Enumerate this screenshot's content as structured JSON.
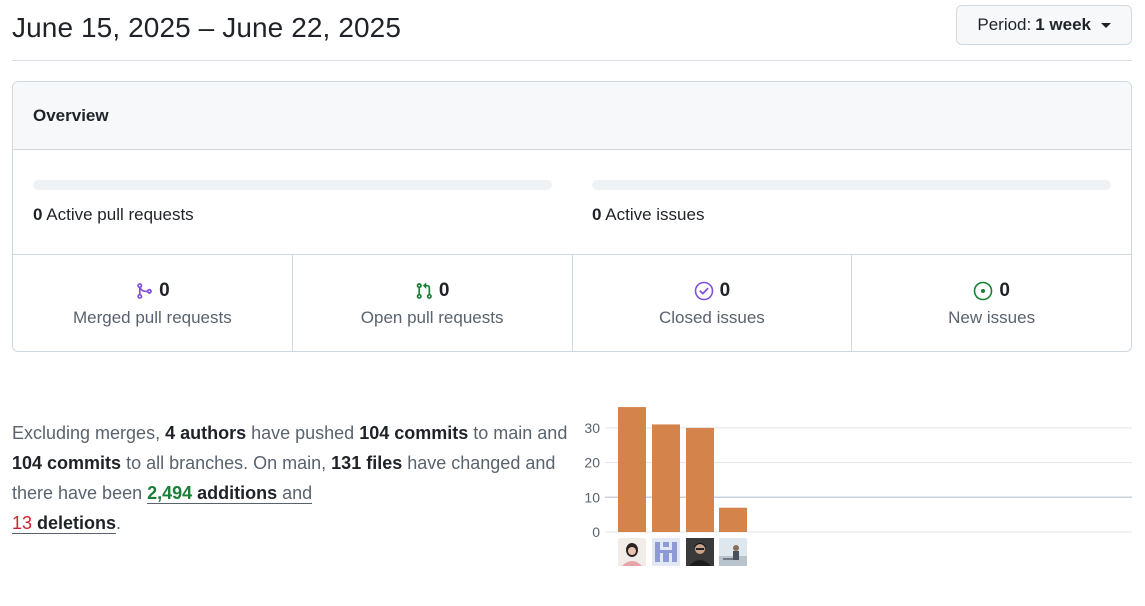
{
  "header": {
    "title": "June 15, 2025 – June 22, 2025",
    "period_label": "Period:",
    "period_value": "1 week"
  },
  "overview": {
    "title": "Overview",
    "active_prs": {
      "count": "0",
      "label": "Active pull requests"
    },
    "active_issues": {
      "count": "0",
      "label": "Active issues"
    },
    "stats": [
      {
        "count": "0",
        "label": "Merged pull requests",
        "icon": "git-merge-icon",
        "color": "#8250df"
      },
      {
        "count": "0",
        "label": "Open pull requests",
        "icon": "git-pull-request-icon",
        "color": "#1a7f37"
      },
      {
        "count": "0",
        "label": "Closed issues",
        "icon": "issue-closed-icon",
        "color": "#8250df"
      },
      {
        "count": "0",
        "label": "New issues",
        "icon": "issue-opened-icon",
        "color": "#1a7f37"
      }
    ]
  },
  "summary": {
    "t1": "Excluding merges, ",
    "authors": "4 authors",
    "t2": " have pushed ",
    "commits_main": "104 commits",
    "t3": " to main and ",
    "commits_all": "104 commits",
    "t4": " to all branches. On main, ",
    "files": "131 files",
    "t5": " have changed and there have been ",
    "additions_num": "2,494",
    "additions_word": " additions",
    "t6": " and",
    "deletions_num": "13",
    "deletions_word": " deletions",
    "t7": "."
  },
  "chart_data": {
    "type": "bar",
    "categories": [
      "author-1",
      "author-2",
      "author-3",
      "author-4"
    ],
    "values": [
      36,
      31,
      30,
      7
    ],
    "yticks": [
      "0",
      "10",
      "20",
      "30"
    ],
    "ylim": [
      0,
      36
    ],
    "bar_color": "#d4834a"
  },
  "colors": {
    "merged": "#8250df",
    "open": "#1a7f37",
    "additions": "#1a7f37",
    "deletions": "#cf222e"
  }
}
